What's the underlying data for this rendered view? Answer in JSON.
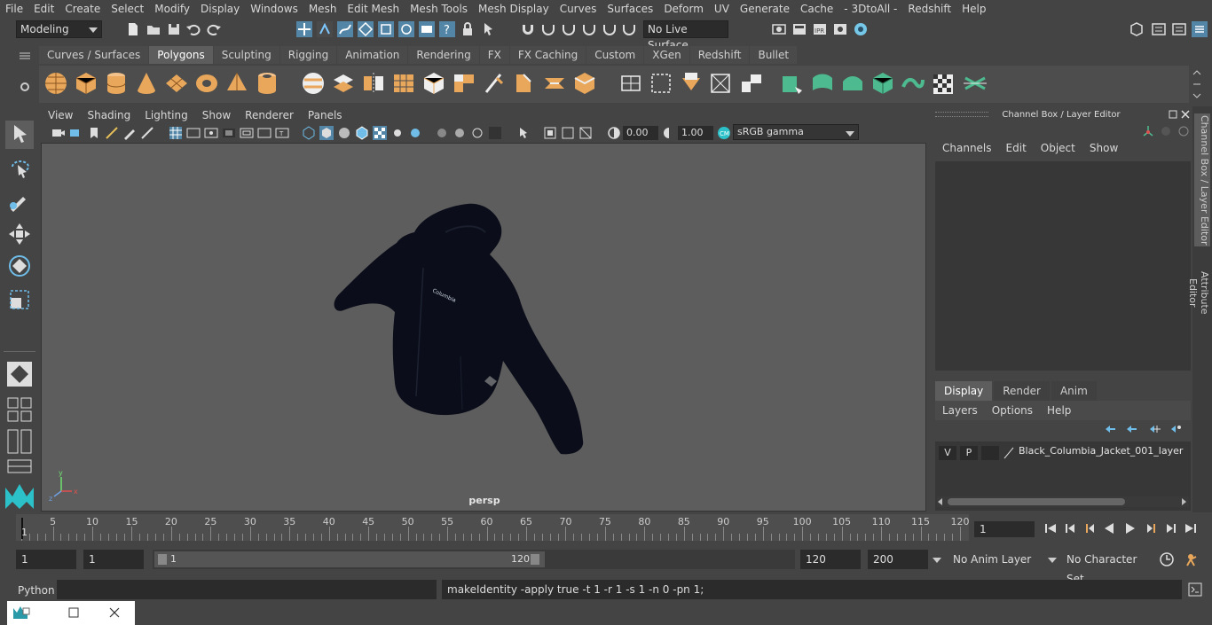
{
  "menubar": {
    "items": [
      "File",
      "Edit",
      "Create",
      "Select",
      "Modify",
      "Display",
      "Windows",
      "Mesh",
      "Edit Mesh",
      "Mesh Tools",
      "Mesh Display",
      "Curves",
      "Surfaces",
      "Deform",
      "UV",
      "Generate",
      "Cache",
      "- 3DtoAll -",
      "Redshift",
      "Help"
    ]
  },
  "status_line": {
    "mode_menu": "Modeling",
    "live_surface": "No Live Surface"
  },
  "shelf": {
    "tabs": [
      "Curves / Surfaces",
      "Polygons",
      "Sculpting",
      "Rigging",
      "Animation",
      "Rendering",
      "FX",
      "FX Caching",
      "Custom",
      "XGen",
      "Redshift",
      "Bullet"
    ],
    "active_tab": "Polygons"
  },
  "viewport": {
    "menu": [
      "View",
      "Shading",
      "Lighting",
      "Show",
      "Renderer",
      "Panels"
    ],
    "exposure": "0.00",
    "gamma": "1.00",
    "color_space": "sRGB gamma",
    "camera_label": "persp",
    "logo_text": "Columbia",
    "axis_labels": {
      "x": "x",
      "y": "y",
      "z": "z"
    }
  },
  "channel_box": {
    "title": "Channel Box / Layer Editor",
    "menu": [
      "Channels",
      "Edit",
      "Object",
      "Show"
    ],
    "display_tabs": [
      "Display",
      "Render",
      "Anim"
    ],
    "active_display_tab": "Display",
    "layer_menu": [
      "Layers",
      "Options",
      "Help"
    ],
    "layer": {
      "visible": "V",
      "playback": "P",
      "name": "Black_Columbia_Jacket_001_layer"
    }
  },
  "side_tabs": [
    "Channel Box / Layer Editor",
    "Attribute Editor"
  ],
  "time_slider": {
    "start": 1,
    "end": 120,
    "major_ticks": [
      5,
      10,
      15,
      20,
      25,
      30,
      35,
      40,
      45,
      50,
      55,
      60,
      65,
      70,
      75,
      80,
      85,
      90,
      95,
      100,
      105,
      110,
      115,
      120
    ],
    "current_frame_field": "1",
    "current_frame_marker": "1"
  },
  "range_slider": {
    "start_field": "1",
    "playback_start_field": "1",
    "slider_start": "1",
    "slider_end": "120",
    "playback_end_field": "120",
    "end_field": "200",
    "anim_layer": "No Anim Layer",
    "character_set": "No Character Set"
  },
  "command_line": {
    "language": "Python",
    "input": "",
    "result": "makeIdentity -apply true -t 1 -r 1 -s 1 -n 0 -pn 1;"
  },
  "colors": {
    "background": "#444444",
    "viewport_bg": "#5d5d5d",
    "icon_orange": "#e8a75a",
    "icon_green": "#4dbb8f",
    "accent_blue": "#5285a6",
    "jacket": "#0b0e1a"
  }
}
